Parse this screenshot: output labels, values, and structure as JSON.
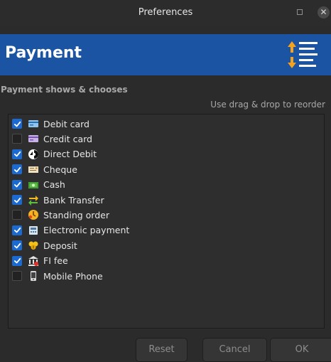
{
  "window": {
    "title": "Preferences"
  },
  "banner": {
    "heading": "Payment"
  },
  "section": {
    "label": "Payment shows & chooses",
    "hint": "Use drag & drop to reorder"
  },
  "payment_methods": [
    {
      "label": "Debit card",
      "checked": true,
      "icon": "debit-card-icon"
    },
    {
      "label": "Credit card",
      "checked": false,
      "icon": "credit-card-icon"
    },
    {
      "label": "Direct Debit",
      "checked": true,
      "icon": "direct-debit-icon"
    },
    {
      "label": "Cheque",
      "checked": true,
      "icon": "cheque-icon"
    },
    {
      "label": "Cash",
      "checked": true,
      "icon": "cash-icon"
    },
    {
      "label": "Bank Transfer",
      "checked": true,
      "icon": "bank-transfer-icon"
    },
    {
      "label": "Standing order",
      "checked": false,
      "icon": "standing-order-icon"
    },
    {
      "label": "Electronic payment",
      "checked": true,
      "icon": "electronic-payment-icon"
    },
    {
      "label": "Deposit",
      "checked": true,
      "icon": "deposit-icon"
    },
    {
      "label": "FI fee",
      "checked": true,
      "icon": "fi-fee-icon"
    },
    {
      "label": "Mobile Phone",
      "checked": false,
      "icon": "mobile-phone-icon"
    }
  ],
  "buttons": {
    "reset": "Reset",
    "cancel": "Cancel",
    "ok": "OK"
  },
  "colors": {
    "banner": "#1b54a3",
    "checkbox_checked": "#1b6ad1",
    "background": "#2b2b2b"
  }
}
